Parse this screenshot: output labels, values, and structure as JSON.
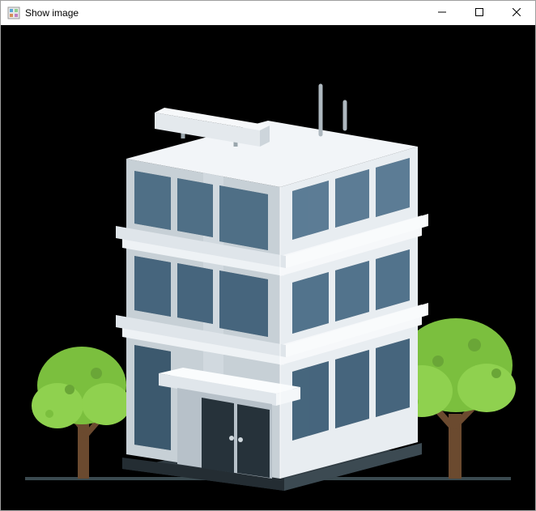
{
  "window": {
    "title": "Show image"
  },
  "image": {
    "description": "office-building-with-trees-illustration"
  }
}
